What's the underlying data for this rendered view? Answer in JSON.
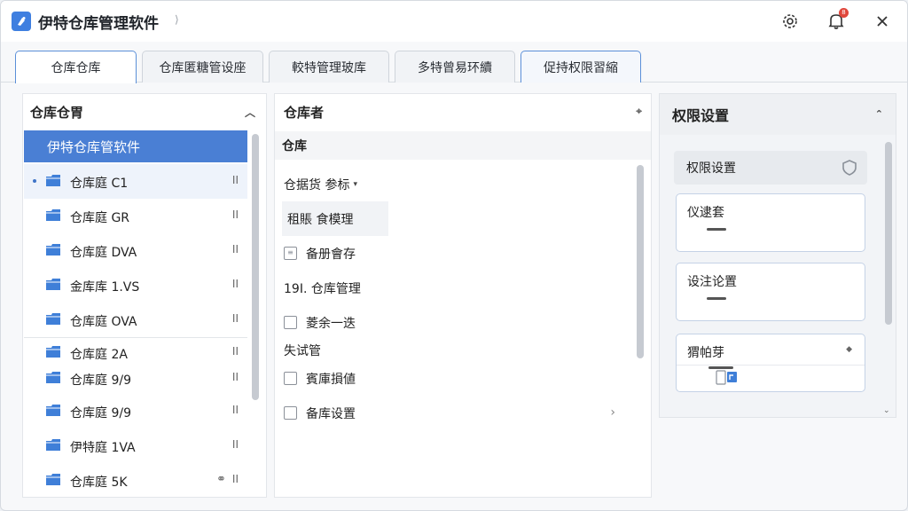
{
  "app": {
    "title": "伊特仓库管理软件"
  },
  "titlebar": {
    "notification_count": "8"
  },
  "tabs": [
    {
      "label": "仓库仓库"
    },
    {
      "label": "仓库匿糖管设座"
    },
    {
      "label": "較特管理玻库"
    },
    {
      "label": "多特曾易环續"
    },
    {
      "label": "促持权限習縮"
    }
  ],
  "left_panel": {
    "title": "仓库仓胃",
    "selected": "伊特仓库管软件",
    "items": [
      {
        "label": "仓库庭 C1",
        "tail": "ІІ"
      },
      {
        "label": "仓库庭 GR",
        "tail": "ІІ"
      },
      {
        "label": "仓库庭 DVA",
        "tail": "ІІ"
      },
      {
        "label": "金库库 1.VS",
        "tail": "ІІ"
      },
      {
        "label": "仓库庭 OVA",
        "tail": "ІІ"
      },
      {
        "label": "仓库庭 2A",
        "tail": "ІІ"
      },
      {
        "label": "仓库庭 9/9",
        "tail": "ІІ"
      },
      {
        "label": "仓库庭 9/9",
        "tail": "ІІ"
      },
      {
        "label": "伊特庭 1VA",
        "tail": "ІІ"
      },
      {
        "label": "仓库庭 5K",
        "tail": "ІІ"
      }
    ]
  },
  "mid_panel": {
    "title": "仓库者",
    "subheader": "仓库",
    "items": [
      {
        "label": "仓据货 参标"
      },
      {
        "label": "租賬 食模理"
      },
      {
        "label": "备册會存"
      },
      {
        "label": "19І. 仓库管理"
      },
      {
        "label": "菱余一迭"
      },
      {
        "label": "失试管"
      },
      {
        "label": "賓庫損値"
      },
      {
        "label": "备库设置"
      }
    ]
  },
  "right_panel": {
    "title": "权限设置",
    "permission_row": "权限设置",
    "cards": [
      {
        "label": "仪逮套"
      },
      {
        "label": "设注论置"
      },
      {
        "label": "猬帕芽"
      }
    ]
  }
}
